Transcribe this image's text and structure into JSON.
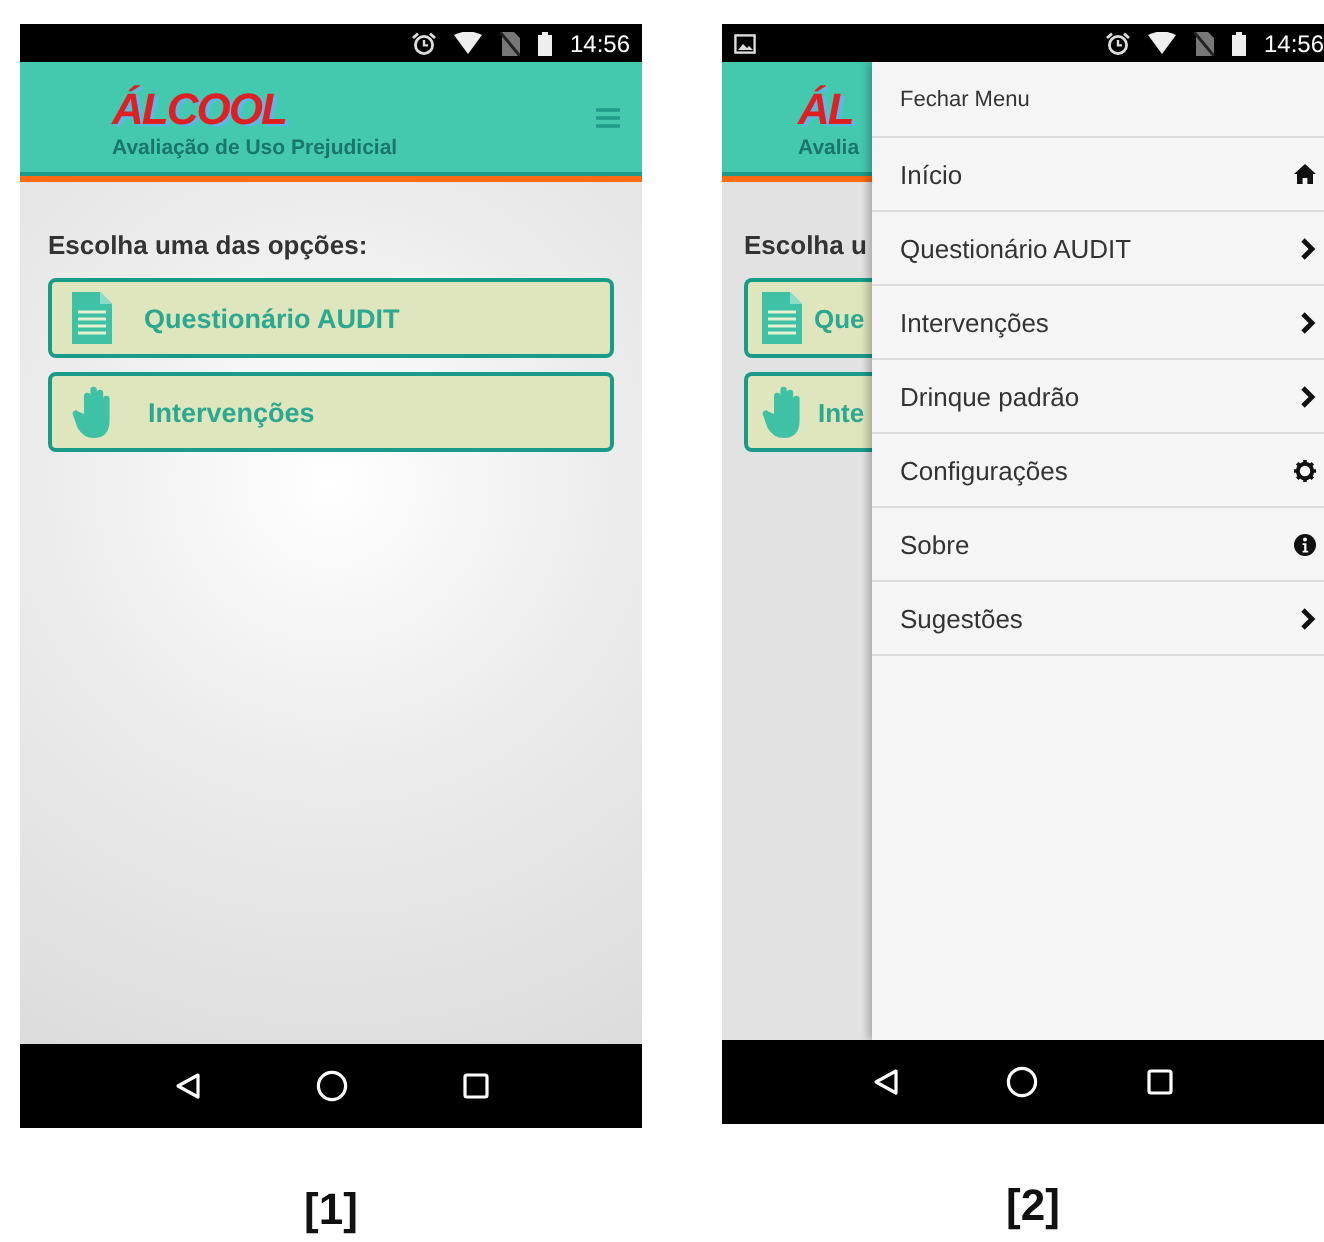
{
  "screen_1": {
    "status_bar": {
      "time": "14:56"
    },
    "header": {
      "logo": "ÁLCOOL",
      "subtitle": "Avaliação de Uso Prejudicial"
    },
    "prompt": "Escolha uma das opções:",
    "options": [
      {
        "label": "Questionário AUDIT",
        "kind": "document"
      },
      {
        "label": "Intervenções",
        "kind": "hand"
      }
    ],
    "caption": "[1]"
  },
  "screen_2": {
    "status_bar": {
      "time": "14:56"
    },
    "background": {
      "logo": "ÁL",
      "subtitle": "Avalia",
      "prompt": "Escolha u",
      "options": [
        {
          "label": "Que",
          "kind": "document"
        },
        {
          "label": "Inte",
          "kind": "hand"
        }
      ]
    },
    "menu": {
      "close_label": "Fechar Menu",
      "items": [
        {
          "label": "Início",
          "kind": "home"
        },
        {
          "label": "Questionário AUDIT",
          "kind": "link"
        },
        {
          "label": "Intervenções",
          "kind": "link"
        },
        {
          "label": "Drinque padrão",
          "kind": "link"
        },
        {
          "label": "Configurações",
          "kind": "settings"
        },
        {
          "label": "Sobre",
          "kind": "info"
        },
        {
          "label": "Sugestões",
          "kind": "link"
        }
      ]
    },
    "caption": "[2]"
  }
}
